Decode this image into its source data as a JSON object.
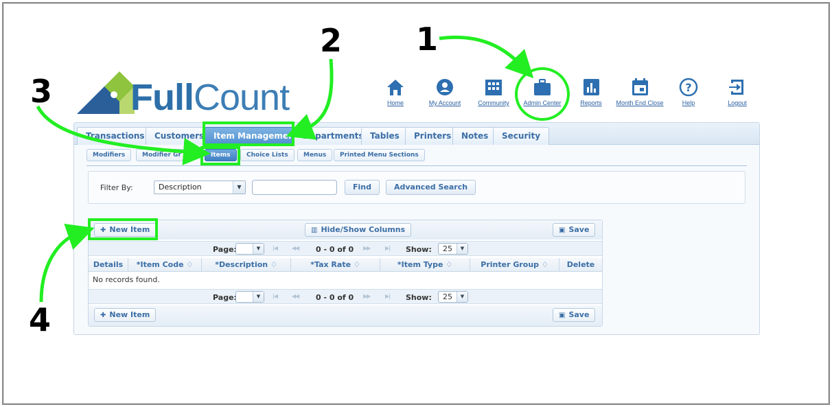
{
  "brand": {
    "full": "Full",
    "count": "Count"
  },
  "topnav": [
    {
      "label": "Home",
      "icon": "home-icon"
    },
    {
      "label": "My Account",
      "icon": "account-icon"
    },
    {
      "label": "Community",
      "icon": "community-icon"
    },
    {
      "label": "Admin Center",
      "icon": "briefcase-icon"
    },
    {
      "label": "Reports",
      "icon": "reports-icon"
    },
    {
      "label": "Month End Close",
      "icon": "calendar-icon"
    },
    {
      "label": "Help",
      "icon": "help-icon"
    },
    {
      "label": "Logout",
      "icon": "logout-icon"
    }
  ],
  "tabs": [
    "Transactions",
    "Customers",
    "Item Management",
    "Departments",
    "Tables",
    "Printers",
    "Notes",
    "Security"
  ],
  "active_tab": "Item Management",
  "subtabs": [
    "Modifiers",
    "Modifier Gr",
    "Items",
    "Choice Lists",
    "Menus",
    "Printed Menu Sections"
  ],
  "active_subtab": "Items",
  "filter": {
    "label": "Filter By:",
    "selected": "Description",
    "search_value": "",
    "find_label": "Find",
    "advanced_label": "Advanced Search"
  },
  "grid": {
    "new_item_label": "New Item",
    "hide_show_label": "Hide/Show Columns",
    "save_label": "Save",
    "page_label": "Page:",
    "range_text": "0 - 0 of 0",
    "show_label": "Show:",
    "page_size": "25",
    "columns": [
      "Details",
      "*Item Code ♢",
      "*Description ♢",
      "*Tax Rate ♢",
      "*Item Type ♢",
      "Printer Group ♢",
      "Delete"
    ],
    "empty_text": "No records found."
  },
  "annotations": [
    "1",
    "2",
    "3",
    "4"
  ],
  "colors": {
    "accent": "#3b6ea5",
    "highlight": "#22ee22",
    "active_tab": "#4f8fcf"
  }
}
